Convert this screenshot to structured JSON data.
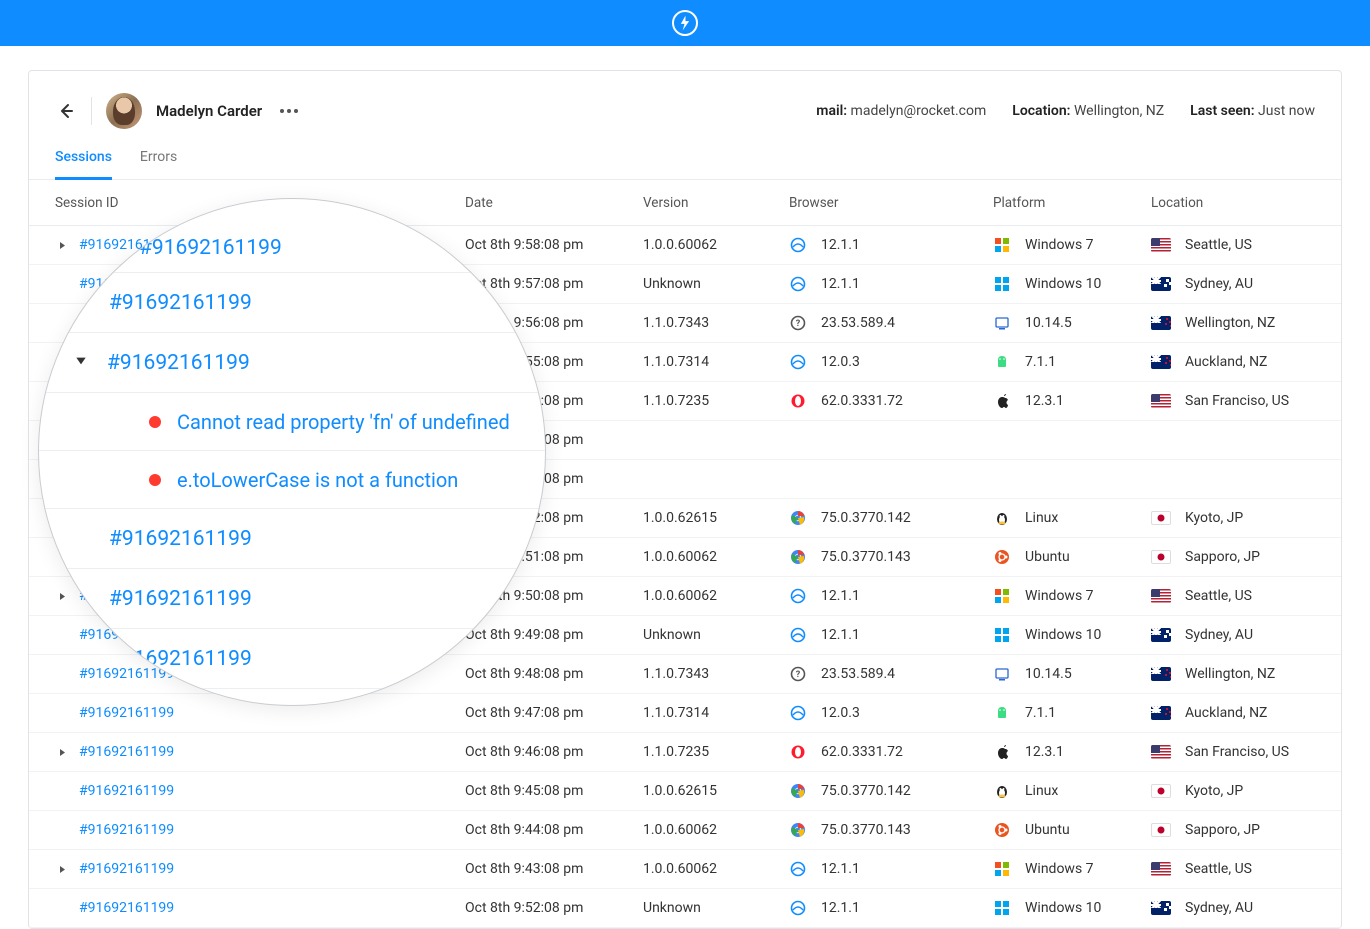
{
  "header": {
    "user_name": "Madelyn Carder",
    "mail_label": "mail:",
    "mail_value": "madelyn@rocket.com",
    "location_label": "Location:",
    "location_value": "Wellington, NZ",
    "lastseen_label": "Last seen:",
    "lastseen_value": "Just now"
  },
  "tabs": {
    "sessions": "Sessions",
    "errors": "Errors"
  },
  "columns": {
    "session_id": "Session ID",
    "date": "Date",
    "version": "Version",
    "browser": "Browser",
    "platform": "Platform",
    "location": "Location"
  },
  "rows": [
    {
      "expand": true,
      "id": "#91692161199",
      "date": "Oct 8th 9:58:08 pm",
      "version": "1.0.0.60062",
      "browser_icon": "ie",
      "browser": "12.1.1",
      "platform_icon": "win7",
      "platform": "Windows 7",
      "flag": "us",
      "location": "Seattle, US"
    },
    {
      "expand": false,
      "id": "#91692161199",
      "date": "Oct 8th 9:57:08 pm",
      "version": "Unknown",
      "browser_icon": "ie",
      "browser": "12.1.1",
      "platform_icon": "win10",
      "platform": "Windows 10",
      "flag": "au",
      "location": "Sydney, AU"
    },
    {
      "expand": false,
      "id": "#91692161199",
      "date": "Oct 8th 9:56:08 pm",
      "version": "1.1.0.7343",
      "browser_icon": "unknown",
      "browser": "23.53.589.4",
      "platform_icon": "mac",
      "platform": "10.14.5",
      "flag": "nz",
      "location": "Wellington, NZ"
    },
    {
      "expand": false,
      "id": "#91692161199",
      "date": "Oct 8th 9:55:08 pm",
      "version": "1.1.0.7314",
      "browser_icon": "ie",
      "browser": "12.0.3",
      "platform_icon": "android",
      "platform": "7.1.1",
      "flag": "nz",
      "location": "Auckland, NZ"
    },
    {
      "expand": false,
      "id": "#91692161199",
      "date": "Oct 8th 9:54:08 pm",
      "version": "1.1.0.7235",
      "browser_icon": "opera",
      "browser": "62.0.3331.72",
      "platform_icon": "apple",
      "platform": "12.3.1",
      "flag": "us",
      "location": "San Franciso, US"
    },
    {
      "expand": false,
      "id": "#91692161199",
      "date": "Oct 8th 9:53:08 pm",
      "version": "",
      "browser_icon": "",
      "browser": "",
      "platform_icon": "",
      "platform": "",
      "flag": "",
      "location": ""
    },
    {
      "expand": false,
      "id": "#91692161199",
      "date": "Oct 8th 9:52:08 pm",
      "version": "",
      "browser_icon": "",
      "browser": "",
      "platform_icon": "",
      "platform": "",
      "flag": "",
      "location": ""
    },
    {
      "expand": false,
      "id": "#91692161199",
      "date": "Oct 8th 9:52:08 pm",
      "version": "1.0.0.62615",
      "browser_icon": "chrome",
      "browser": "75.0.3770.142",
      "platform_icon": "linux",
      "platform": "Linux",
      "flag": "jp",
      "location": "Kyoto, JP"
    },
    {
      "expand": false,
      "id": "#91692161199",
      "date": "Oct 8th 9:51:08 pm",
      "version": "1.0.0.60062",
      "browser_icon": "chrome",
      "browser": "75.0.3770.143",
      "platform_icon": "ubuntu",
      "platform": "Ubuntu",
      "flag": "jp",
      "location": "Sapporo, JP"
    },
    {
      "expand": true,
      "id": "#91692161199",
      "date": "Oct 8th 9:50:08 pm",
      "version": "1.0.0.60062",
      "browser_icon": "ie",
      "browser": "12.1.1",
      "platform_icon": "win7",
      "platform": "Windows 7",
      "flag": "us",
      "location": "Seattle, US"
    },
    {
      "expand": false,
      "id": "#91692161199",
      "date": "Oct 8th 9:49:08 pm",
      "version": "Unknown",
      "browser_icon": "ie",
      "browser": "12.1.1",
      "platform_icon": "win10",
      "platform": "Windows 10",
      "flag": "au",
      "location": "Sydney, AU"
    },
    {
      "expand": false,
      "id": "#91692161199",
      "date": "Oct 8th 9:48:08 pm",
      "version": "1.1.0.7343",
      "browser_icon": "unknown",
      "browser": "23.53.589.4",
      "platform_icon": "mac",
      "platform": "10.14.5",
      "flag": "nz",
      "location": "Wellington, NZ"
    },
    {
      "expand": false,
      "id": "#91692161199",
      "date": "Oct 8th 9:47:08 pm",
      "version": "1.1.0.7314",
      "browser_icon": "ie",
      "browser": "12.0.3",
      "platform_icon": "android",
      "platform": "7.1.1",
      "flag": "nz",
      "location": "Auckland, NZ"
    },
    {
      "expand": true,
      "id": "#91692161199",
      "date": "Oct 8th 9:46:08 pm",
      "version": "1.1.0.7235",
      "browser_icon": "opera",
      "browser": "62.0.3331.72",
      "platform_icon": "apple",
      "platform": "12.3.1",
      "flag": "us",
      "location": "San Franciso, US"
    },
    {
      "expand": false,
      "id": "#91692161199",
      "date": "Oct 8th 9:45:08 pm",
      "version": "1.0.0.62615",
      "browser_icon": "chrome",
      "browser": "75.0.3770.142",
      "platform_icon": "linux",
      "platform": "Linux",
      "flag": "jp",
      "location": "Kyoto, JP"
    },
    {
      "expand": false,
      "id": "#91692161199",
      "date": "Oct 8th 9:44:08 pm",
      "version": "1.0.0.60062",
      "browser_icon": "chrome",
      "browser": "75.0.3770.143",
      "platform_icon": "ubuntu",
      "platform": "Ubuntu",
      "flag": "jp",
      "location": "Sapporo, JP"
    },
    {
      "expand": true,
      "id": "#91692161199",
      "date": "Oct 8th 9:43:08 pm",
      "version": "1.0.0.60062",
      "browser_icon": "ie",
      "browser": "12.1.1",
      "platform_icon": "win7",
      "platform": "Windows 7",
      "flag": "us",
      "location": "Seattle, US"
    },
    {
      "expand": false,
      "id": "#91692161199",
      "date": "Oct 8th 9:52:08 pm",
      "version": "Unknown",
      "browser_icon": "ie",
      "browser": "12.1.1",
      "platform_icon": "win10",
      "platform": "Windows 10",
      "flag": "au",
      "location": "Sydney, AU"
    }
  ],
  "magnifier": {
    "s1": "#91692161199",
    "s2": "#91692161199",
    "s3": "#91692161199",
    "err1": "Cannot read property 'fn' of undefined",
    "err2": "e.toLowerCase is not a function",
    "s4": "#91692161199",
    "s5": "#91692161199",
    "s6": "#91692161199"
  }
}
